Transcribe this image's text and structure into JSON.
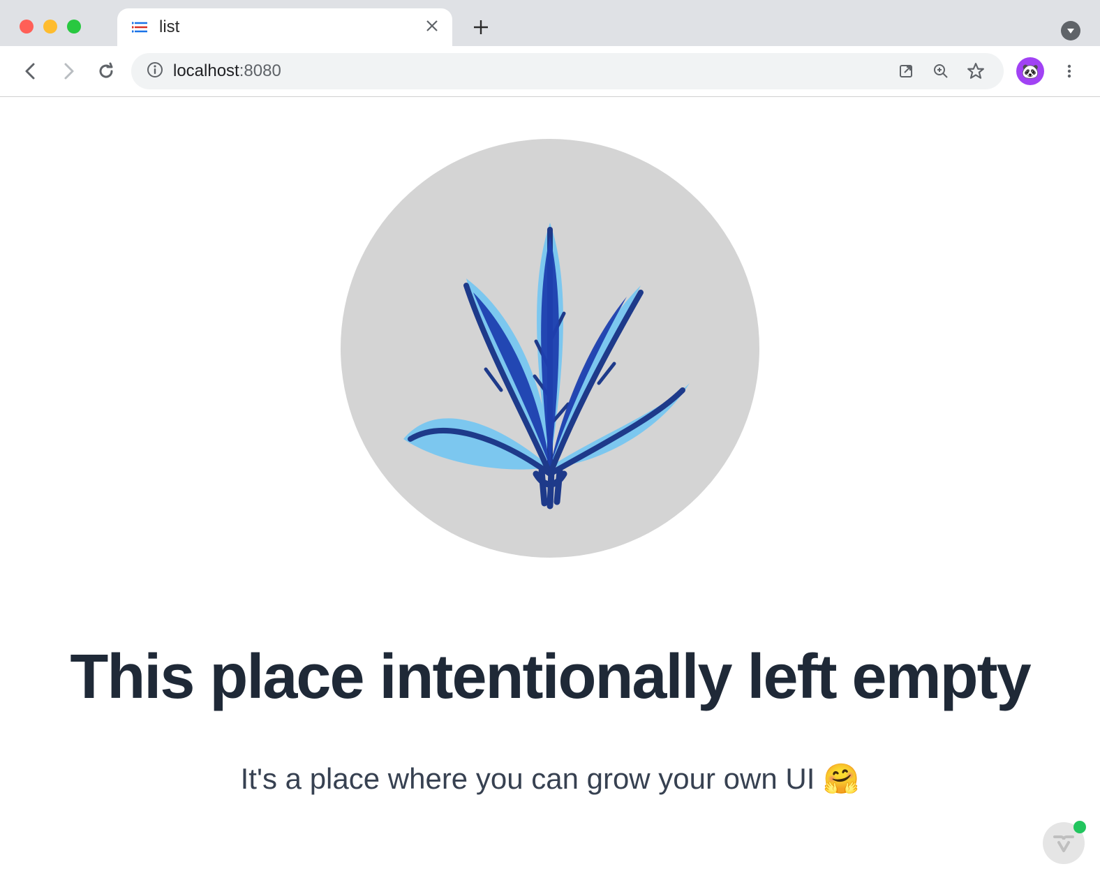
{
  "browser": {
    "tab": {
      "title": "list",
      "favicon": "list-icon"
    },
    "new_tab_label": "+",
    "url": {
      "host": "localhost",
      "port": ":8080"
    },
    "avatar_emoji": "🐼"
  },
  "page": {
    "illustration": "blue-plant",
    "headline": "This place intentionally left empty",
    "subline": "It's a place where you can grow your own UI 🤗"
  },
  "float_badge": {
    "icon": "vaadin-logo",
    "status": "online"
  }
}
